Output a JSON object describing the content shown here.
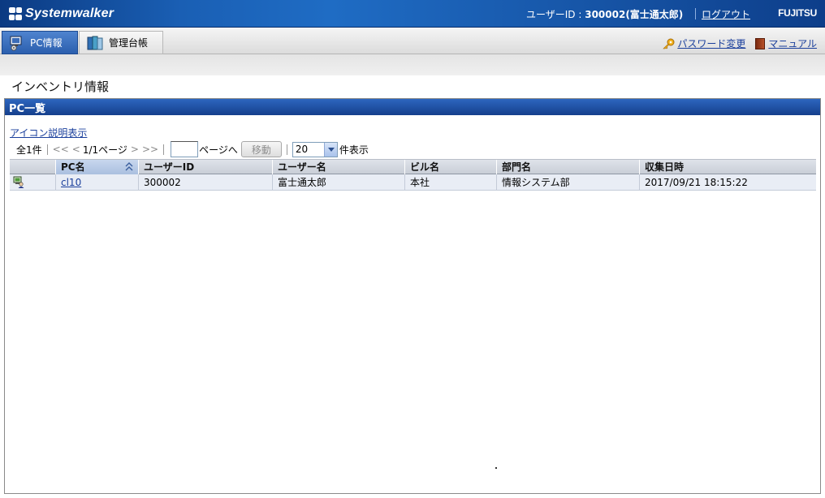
{
  "header": {
    "logo_text": "Systemwalker",
    "user_prefix": "ユーザーID : ",
    "user_value": "300002(富士通太郎)",
    "logout_label": "ログアウト",
    "vendor": "FUJITSU"
  },
  "tabs": [
    {
      "label": "PC情報",
      "active": true
    },
    {
      "label": "管理台帳",
      "active": false
    }
  ],
  "links": {
    "password_label": "パスワード変更",
    "manual_label": "マニュアル"
  },
  "page": {
    "title": "インベントリ情報"
  },
  "panel": {
    "title": "PC一覧",
    "icon_legend_link": "アイコン説明表示"
  },
  "pager": {
    "total": "全1件",
    "first": "<<",
    "prev": "<",
    "current": "1/1ページ",
    "next": ">",
    "last": ">>",
    "input_value": "",
    "goto_suffix": "ページへ",
    "move_label": "移動",
    "per_page_value": "20",
    "per_page_suffix": "件表示"
  },
  "table": {
    "columns": [
      "",
      "PC名",
      "ユーザーID",
      "ユーザー名",
      "ビル名",
      "部門名",
      "収集日時"
    ],
    "rows": [
      {
        "icon": "pc-user-icon",
        "pc_name": "cl10",
        "user_id": "300002",
        "user_name": "富士通太郎",
        "building": "本社",
        "department": "情報システム部",
        "collected_at": "2017/09/21 18:15:22"
      }
    ]
  },
  "colors": {
    "header_blue": "#1a5fb4",
    "link_blue": "#1a3f9c",
    "panel_head": "#153f8c"
  }
}
